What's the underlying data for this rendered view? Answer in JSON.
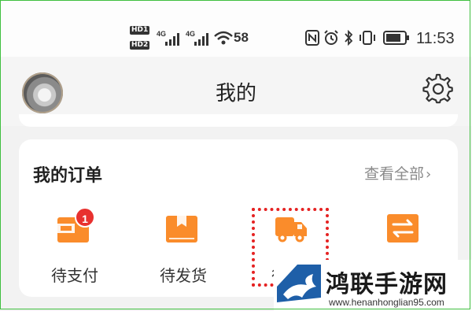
{
  "status_bar": {
    "sim1": "HD",
    "sim1_num": "1",
    "sim2": "HD",
    "sim2_num": "2",
    "net1": "4G",
    "net2": "4G",
    "wifi_speed": "58",
    "time": "11:53"
  },
  "header": {
    "title": "我的"
  },
  "orders": {
    "title": "我的订单",
    "view_all": "查看全部",
    "items": [
      {
        "label": "待支付",
        "badge": "1",
        "icon": "wallet-icon"
      },
      {
        "label": "待发货",
        "icon": "package-icon"
      },
      {
        "label": "待",
        "icon": "delivery-truck-icon"
      },
      {
        "label": "",
        "icon": "exchange-arrows-icon"
      }
    ]
  },
  "watermark": {
    "name": "鸿联手游网",
    "url": "www.henanhonglian95.com"
  },
  "colors": {
    "accent": "#fa8c2b",
    "badge": "#e8312f",
    "highlight": "#e52222",
    "frame": "#3fbf3f"
  }
}
